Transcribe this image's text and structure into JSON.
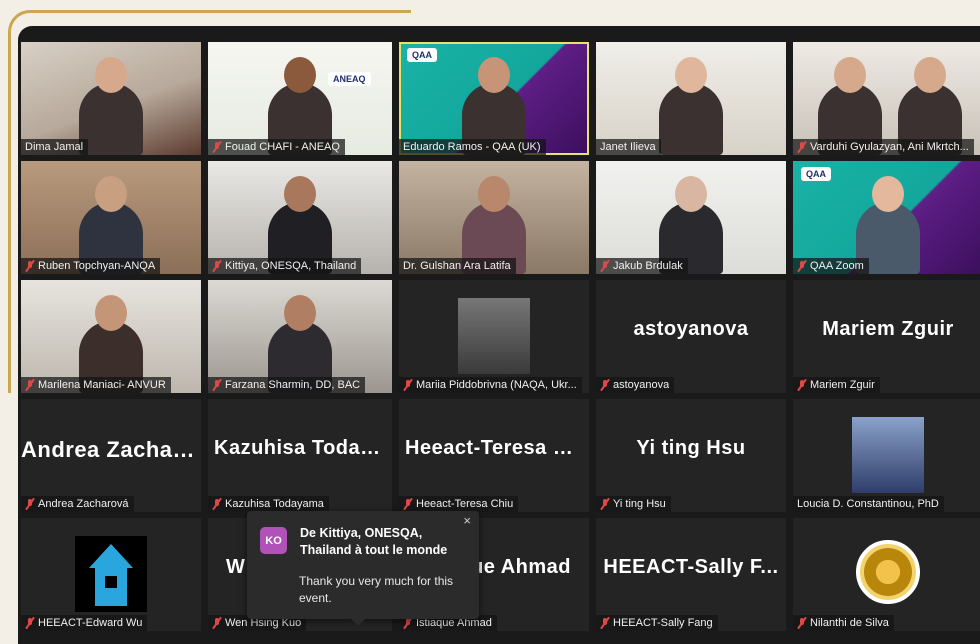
{
  "participants": [
    {
      "name": "Dima Jamal",
      "muted": false
    },
    {
      "name": "Fouad CHAFI - ANEAQ",
      "muted": true,
      "logo": "ANEAQ"
    },
    {
      "name": "Eduardo Ramos - QAA (UK)",
      "muted": false,
      "logo": "QAA",
      "active": true
    },
    {
      "name": "Janet Ilieva",
      "muted": false
    },
    {
      "name": "Varduhi Gyulazyan, Ani Mkrtch...",
      "muted": true
    },
    {
      "name": "Ruben Topchyan-ANQA",
      "muted": true
    },
    {
      "name": "Kittiya, ONESQA, Thailand",
      "muted": true
    },
    {
      "name": "Dr. Gulshan Ara Latifa",
      "muted": false
    },
    {
      "name": "Jakub Brdulak",
      "muted": true
    },
    {
      "name": "QAA Zoom",
      "muted": true,
      "logo": "QAA"
    },
    {
      "name": "Marilena Maniaci- ANVUR",
      "muted": true
    },
    {
      "name": "Farzana Sharmin, DD, BAC",
      "muted": true
    },
    {
      "name": "Mariia Piddobrivna (NAQA, Ukr...",
      "muted": true
    },
    {
      "name": "astoyanova",
      "muted": true,
      "display": "astoyanova"
    },
    {
      "name": "Mariem Zguir",
      "muted": true,
      "display": "Mariem Zguir"
    },
    {
      "name": "Andrea Zacharová",
      "muted": true,
      "display": "Andrea Zacharo..."
    },
    {
      "name": "Kazuhisa Todayama",
      "muted": true,
      "display": "Kazuhisa Today..."
    },
    {
      "name": "Heeact-Teresa Chiu",
      "muted": true,
      "display": "Heeact-Teresa C..."
    },
    {
      "name": "Yi ting Hsu",
      "muted": true,
      "display": "Yi ting Hsu"
    },
    {
      "name": "Loucia D. Constantinou, PhD",
      "muted": false
    },
    {
      "name": "HEEACT-Edward Wu",
      "muted": true
    },
    {
      "name": "Wen Hsing Kuo",
      "muted": true,
      "display": "W"
    },
    {
      "name": "Istiaque Ahmad",
      "muted": true,
      "display": "ue Ahmad"
    },
    {
      "name": "HEEACT-Sally Fang",
      "muted": true,
      "display": "HEEACT-Sally F..."
    },
    {
      "name": "Nilanthi de Silva",
      "muted": true
    }
  ],
  "chat": {
    "avatar_initials": "KO",
    "from": "De Kittiya, ONESQA, Thailand à tout le monde",
    "message": "Thank you very much for this event.",
    "close": "×"
  }
}
